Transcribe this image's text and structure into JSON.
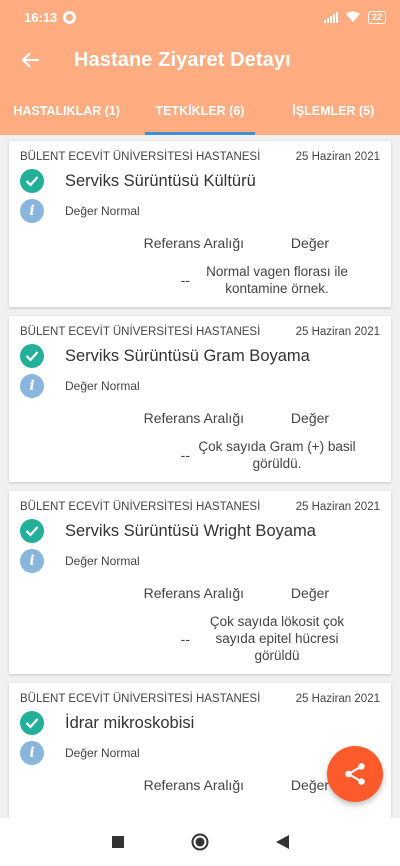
{
  "status_bar": {
    "time": "16:13",
    "battery": "22"
  },
  "header": {
    "title": "Hastane Ziyaret Detayı"
  },
  "tabs": [
    {
      "label": "HASTALIKLAR (1)",
      "active": false
    },
    {
      "label": "TETKİKLER (6)",
      "active": true
    },
    {
      "label": "İŞLEMLER (5)",
      "active": false
    }
  ],
  "table_headers": {
    "reference": "Referans Aralığı",
    "value": "Değer"
  },
  "cards": [
    {
      "hospital": "BÜLENT ECEVİT ÜNİVERSİTESİ HASTANESİ",
      "date": "25 Haziran 2021",
      "test": "Serviks Sürüntüsü Kültürü",
      "status": "Değer Normal",
      "reference": "--",
      "value": "Normal vagen florası ile kontamine örnek."
    },
    {
      "hospital": "BÜLENT ECEVİT ÜNİVERSİTESİ HASTANESİ",
      "date": "25 Haziran 2021",
      "test": "Serviks Sürüntüsü Gram Boyama",
      "status": "Değer Normal",
      "reference": "--",
      "value": "Çok sayıda Gram (+) basil görüldü."
    },
    {
      "hospital": "BÜLENT ECEVİT ÜNİVERSİTESİ HASTANESİ",
      "date": "25 Haziran 2021",
      "test": "Serviks Sürüntüsü Wright Boyama",
      "status": "Değer Normal",
      "reference": "--",
      "value": "Çok sayıda lökosit çok sayıda epitel hücresi görüldü"
    },
    {
      "hospital": "BÜLENT ECEVİT ÜNİVERSİTESİ HASTANESİ",
      "date": "25 Haziran 2021",
      "test": "İdrar mikroskobisi",
      "status": "Değer Normal",
      "reference": "",
      "value": ""
    }
  ],
  "colors": {
    "header": "#ffac80",
    "tab_indicator": "#3e8fd8",
    "check": "#22b098",
    "info": "#8ab6dd",
    "fab": "#ff5a2b"
  },
  "icons": {
    "back": "arrow-left-icon",
    "check": "check-circle-icon",
    "info": "info-icon",
    "share": "share-icon"
  }
}
